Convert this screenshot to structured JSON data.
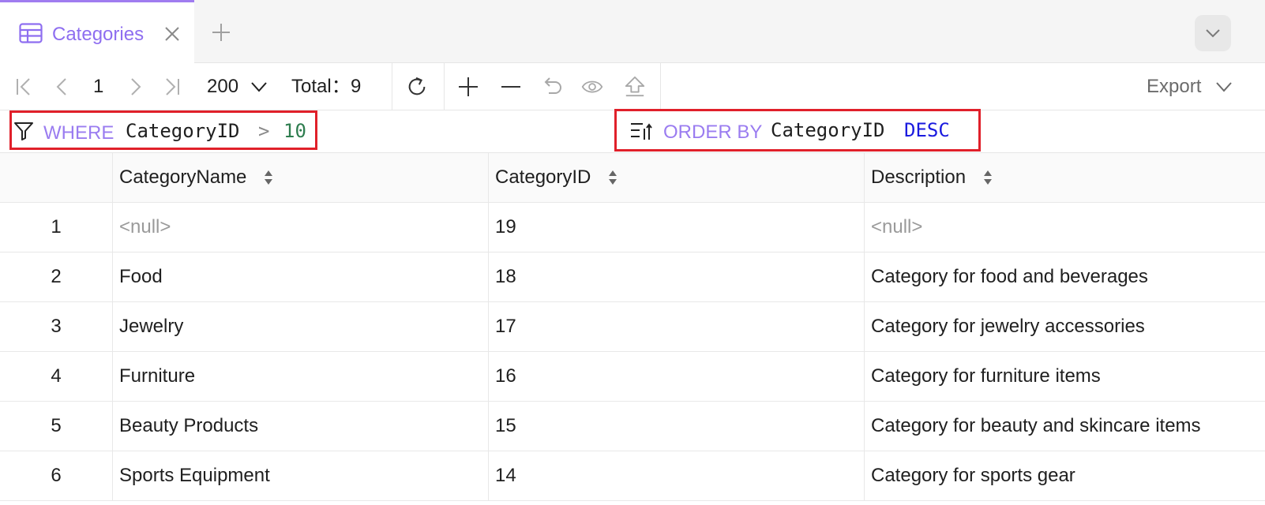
{
  "tab": {
    "label": "Categories"
  },
  "toolbar": {
    "page": "1",
    "page_size": "200",
    "total_label": "Total：",
    "total_value": "9",
    "export_label": "Export"
  },
  "filter": {
    "where_kw": "WHERE",
    "where_column": "CategoryID",
    "where_op": ">",
    "where_value": "10",
    "order_kw": "ORDER BY",
    "order_column": "CategoryID",
    "order_dir": "DESC"
  },
  "colors": {
    "accent": "#8e6ef0",
    "highlight_border": "#e0202a",
    "number_literal": "#2e7d4f",
    "keyword_blue": "#1a1adf"
  },
  "grid": {
    "columns": [
      "CategoryName",
      "CategoryID",
      "Description"
    ],
    "rows": [
      {
        "num": "1",
        "name": "<null>",
        "id": "19",
        "desc": "<null>"
      },
      {
        "num": "2",
        "name": "Food",
        "id": "18",
        "desc": "Category for food and beverages"
      },
      {
        "num": "3",
        "name": "Jewelry",
        "id": "17",
        "desc": "Category for jewelry accessories"
      },
      {
        "num": "4",
        "name": "Furniture",
        "id": "16",
        "desc": "Category for furniture items"
      },
      {
        "num": "5",
        "name": "Beauty Products",
        "id": "15",
        "desc": "Category for beauty and skincare items"
      },
      {
        "num": "6",
        "name": "Sports Equipment",
        "id": "14",
        "desc": "Category for sports gear"
      }
    ]
  }
}
